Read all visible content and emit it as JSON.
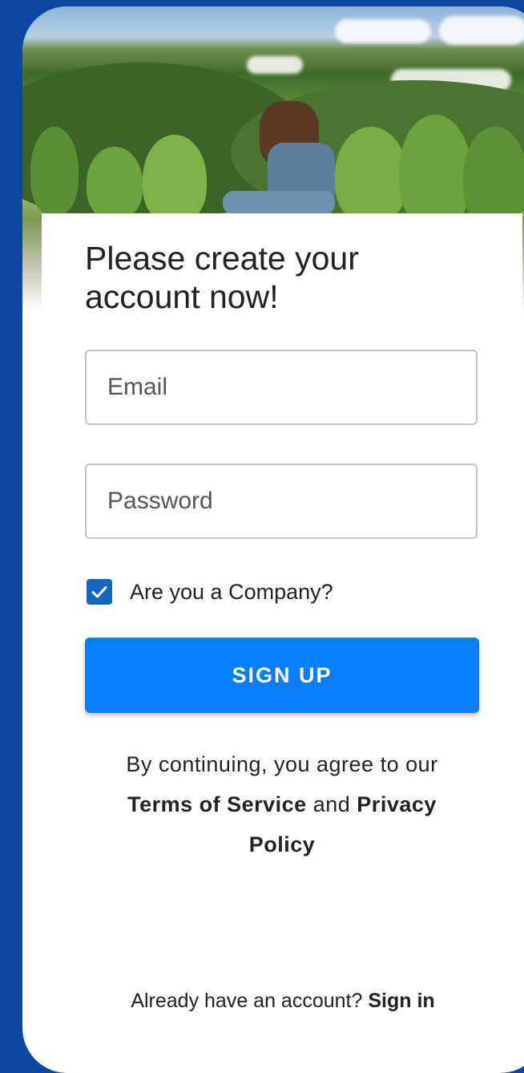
{
  "heading": {
    "line1": "Please create your",
    "line2": "account now!"
  },
  "email": {
    "placeholder": "Email"
  },
  "password": {
    "placeholder": "Password"
  },
  "company_checkbox": {
    "label": "Are you a Company?",
    "checked": true
  },
  "signup_button": {
    "label": "SIGN UP"
  },
  "terms": {
    "prefix": "By continuing, you agree to our",
    "tos_link": "Terms of Service",
    "and": "and",
    "privacy_link": "Privacy",
    "privacy_link_2": "Policy"
  },
  "signin": {
    "prompt": "Already have an account?",
    "link": "Sign in"
  },
  "colors": {
    "background": "#0d47a1",
    "primary_button": "#0a7cff",
    "checkbox": "#1565c0"
  },
  "icons": {
    "checkbox_mark": "check-icon"
  }
}
